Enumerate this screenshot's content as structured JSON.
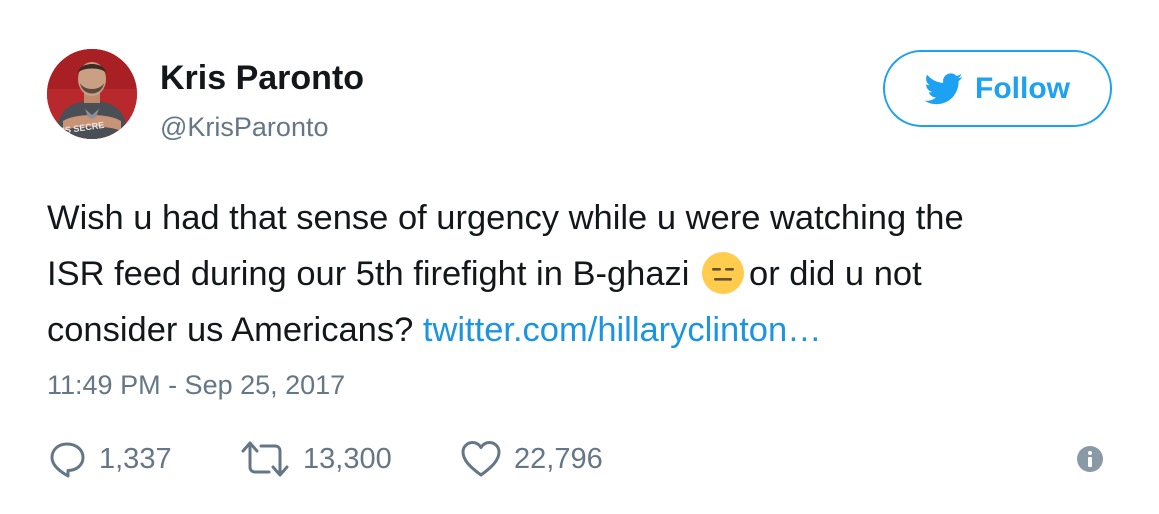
{
  "user": {
    "display_name": "Kris Paronto",
    "handle": "@KrisParonto",
    "avatar_icon": "profile-photo",
    "avatar_shirt_text": "ERS SECRE"
  },
  "follow_button": {
    "label": "Follow",
    "icon": "twitter-bird-icon",
    "color": "#1da1f2"
  },
  "tweet": {
    "line1": "Wish u had that sense of urgency while u were watching the",
    "line2_before_emoji": "ISR feed during our 5th firefight in B-ghazi",
    "emoji": "expressionless-face",
    "line2_after_emoji": "or did u not",
    "line3_text": "consider us Americans?",
    "link_text": "twitter.com/hillaryclinton…",
    "link_color": "#1b95e0"
  },
  "timestamp": "11:49 PM - Sep 25, 2017",
  "actions": {
    "replies": {
      "icon": "reply-icon",
      "count": "1,337"
    },
    "retweets": {
      "icon": "retweet-icon",
      "count": "13,300"
    },
    "likes": {
      "icon": "heart-icon",
      "count": "22,796"
    },
    "info": {
      "icon": "info-icon"
    }
  },
  "colors": {
    "text": "#14171a",
    "secondary": "#657786",
    "accent": "#1da1f2"
  }
}
